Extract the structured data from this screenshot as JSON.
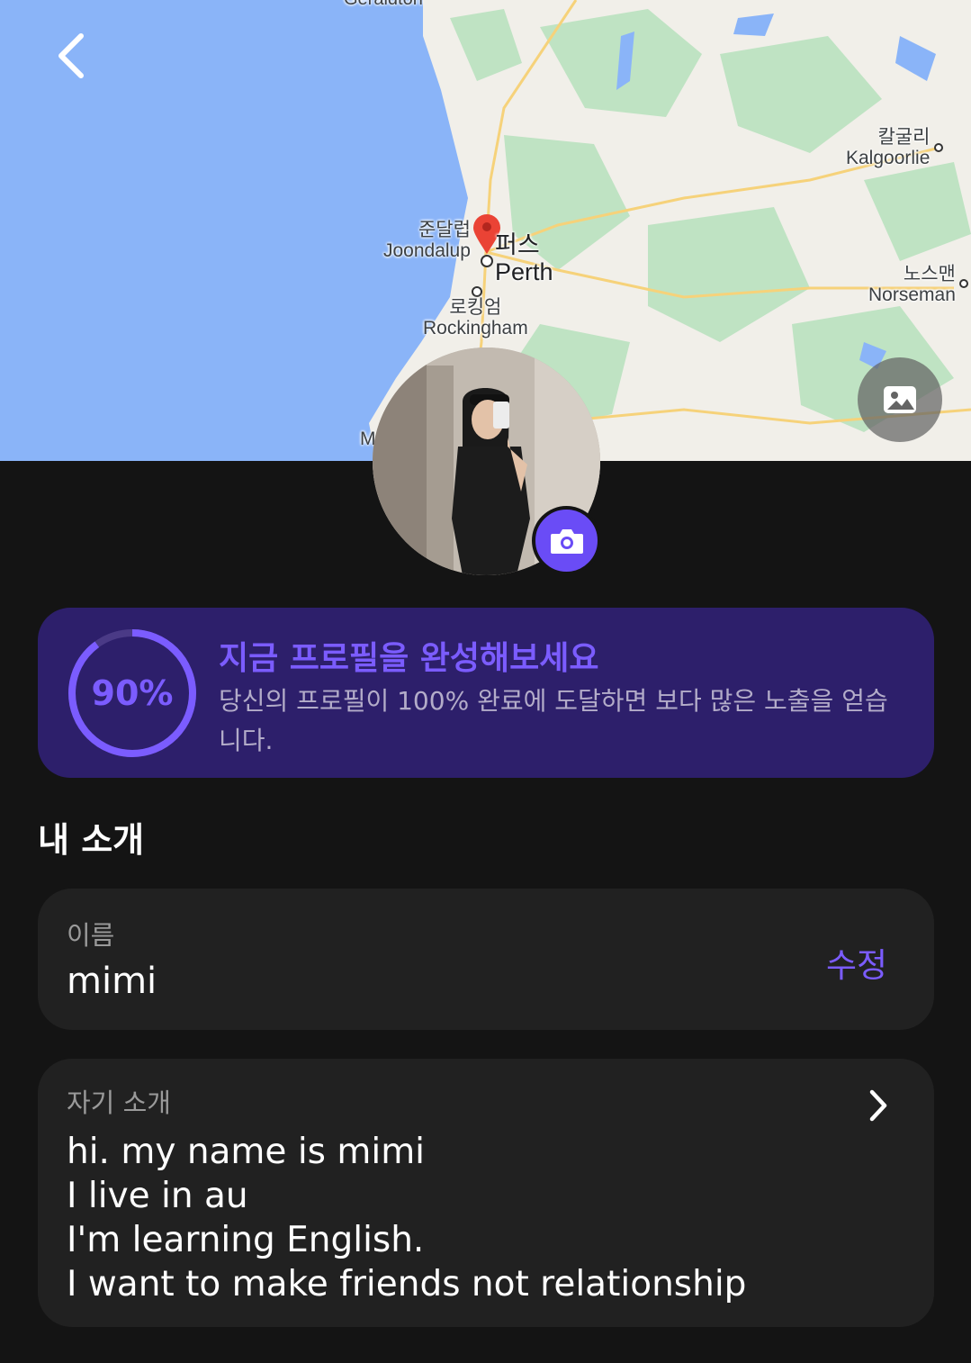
{
  "map": {
    "labels": {
      "geraldton": "Geraldton",
      "joondalup_ko": "준달럽",
      "joondalup_en": "Joondalup",
      "perth_ko": "퍼스",
      "perth_en": "Perth",
      "rockingham_ko": "로킹엄",
      "rockingham_en": "Rockingham",
      "kalgoorlie_ko": "칼굴리",
      "kalgoorlie_en": "Kalgoorlie",
      "norseman_ko": "노스맨",
      "norseman_en": "Norseman",
      "m": "M"
    },
    "colors": {
      "ocean": "#8ab4f8",
      "land": "#f1efe9",
      "green": "#bfe3c3",
      "pin": "#ea4335",
      "road": "#f6d27a"
    }
  },
  "icons": {
    "back": "chevron-left-icon",
    "gallery": "image-icon",
    "camera": "camera-icon",
    "bio_open": "chevron-right-icon"
  },
  "profile_completion": {
    "percent_label": "90%",
    "fraction": 0.9,
    "title": "지금 프로필을 완성해보세요",
    "description": "당신의 프로필이 100% 완료에 도달하면 보다 많은 노출을 얻습니다."
  },
  "about": {
    "section_title": "내 소개",
    "name_label": "이름",
    "name_value": "mimi",
    "edit_label": "수정",
    "bio_label": "자기 소개",
    "bio_lines": [
      "hi. my name is mimi",
      "I live in au",
      "I'm learning English.",
      "I want to make friends not relationship"
    ]
  },
  "colors": {
    "accent": "#7b5cff",
    "card_bg": "#212121",
    "progress_bg": "#2d1f6b",
    "page_bg": "#141414"
  }
}
